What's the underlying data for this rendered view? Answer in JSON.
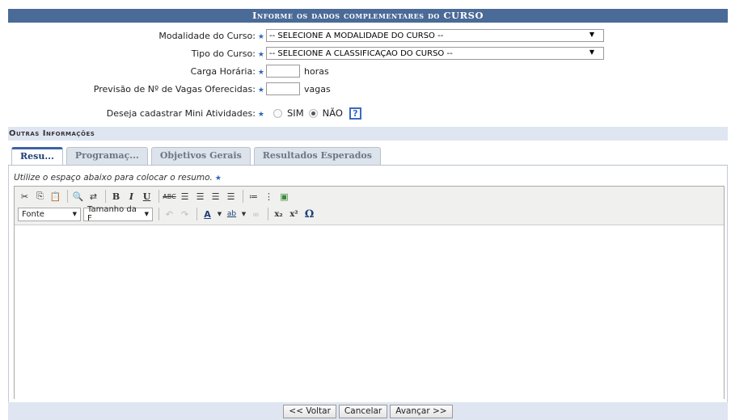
{
  "title": "Informe os dados complementares do CURSO",
  "form": {
    "modalidade": {
      "label": "Modalidade do Curso:",
      "value": "-- SELECIONE A MODALIDADE DO CURSO --"
    },
    "tipo": {
      "label": "Tipo do Curso:",
      "value": "-- SELECIONE A CLASSIFICAÇÃO DO CURSO --"
    },
    "carga": {
      "label": "Carga Horária:",
      "value": "",
      "unit": "horas"
    },
    "vagas": {
      "label": "Previsão de Nº de Vagas Oferecidas:",
      "value": "",
      "unit": "vagas"
    },
    "mini": {
      "label": "Deseja cadastrar Mini Atividades:",
      "option_yes": "SIM",
      "option_no": "NÃO",
      "selected": "NÃO",
      "help": "?"
    },
    "required_mark": "★"
  },
  "section": {
    "title": "Outras Informações"
  },
  "tabs": [
    {
      "label": "Resu...",
      "active": true
    },
    {
      "label": "Programaç...",
      "active": false
    },
    {
      "label": "Objetivos Gerais",
      "active": false
    },
    {
      "label": "Resultados Esperados",
      "active": false
    }
  ],
  "editor": {
    "hint": "Utilize o espaço abaixo para colocar o resumo.",
    "font_select": "Fonte",
    "size_select": "Tamanho da F",
    "toolbar_icons": [
      "cut-icon",
      "copy-icon",
      "paste-icon",
      "find-icon",
      "replace-icon",
      "bold-icon",
      "italic-icon",
      "underline-icon",
      "strikethrough-icon",
      "align-left-icon",
      "align-center-icon",
      "align-right-icon",
      "align-justify-icon",
      "unordered-list-icon",
      "ordered-list-icon",
      "image-icon",
      "undo-icon",
      "redo-icon",
      "text-color-icon",
      "highlight-color-icon",
      "link-icon",
      "subscript-icon",
      "superscript-icon",
      "special-char-icon"
    ]
  },
  "footer": {
    "back": "<< Voltar",
    "cancel": "Cancelar",
    "next": "Avançar >>"
  },
  "colors": {
    "title_bg": "#4a6a97",
    "section_bg": "#dfe6f2",
    "star": "#2f65b8",
    "tab_active_border": "#3a63a8"
  }
}
